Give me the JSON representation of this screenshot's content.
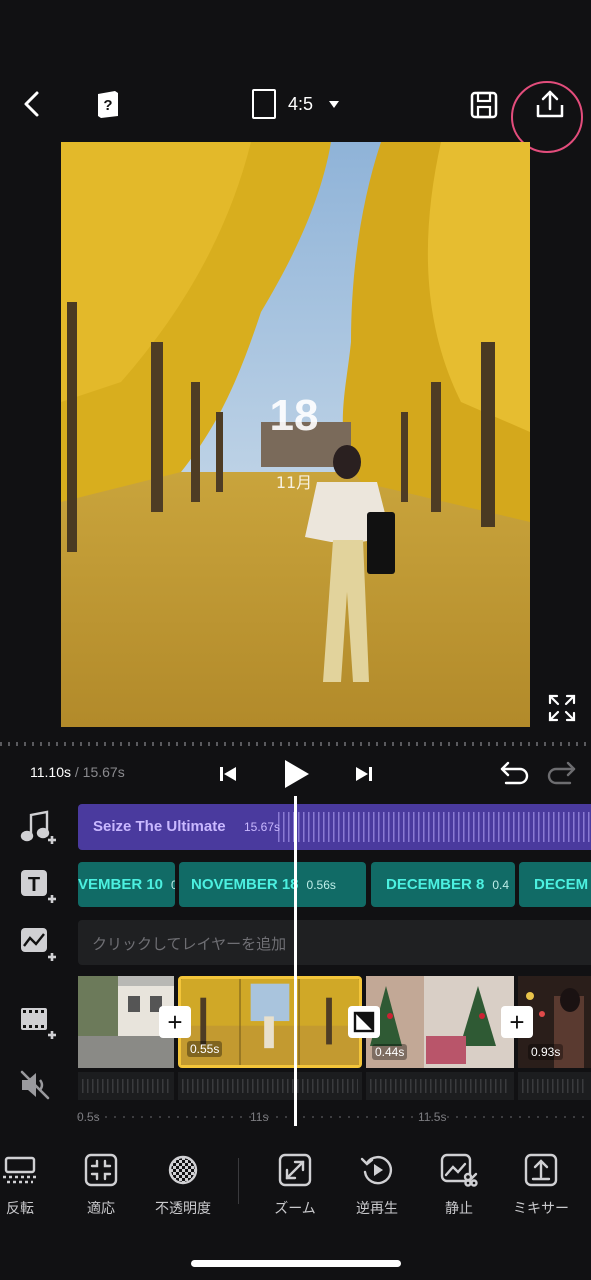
{
  "header": {
    "back_icon": "chevron-left-icon",
    "help_icon": "help-book-icon",
    "ratio_label": "4:5",
    "save_icon": "save-icon",
    "export_icon": "upload-icon",
    "highlight_color": "#e34d7c"
  },
  "preview": {
    "overlay_number": "18",
    "overlay_sub": "11月",
    "fullscreen_icon": "expand-icon"
  },
  "playback": {
    "current_time": "11.10s",
    "separator": " / ",
    "total_time": "15.67s",
    "undo_icon": "undo-icon",
    "redo_icon": "redo-icon"
  },
  "music": {
    "title": "Seize The Ultimate",
    "duration": "15.67s",
    "color": "#4a3a9e"
  },
  "text_clips": [
    {
      "label": "VEMBER 10",
      "dur": "0."
    },
    {
      "label": "NOVEMBER 18",
      "dur": "0.56s"
    },
    {
      "label": "DECEMBER 8",
      "dur": "0.4"
    },
    {
      "label": "DECEM",
      "dur": ""
    }
  ],
  "layer": {
    "placeholder": "クリックしてレイヤーを追加"
  },
  "video_clips": [
    {
      "dur": ""
    },
    {
      "dur": "0.55s"
    },
    {
      "dur": "0.44s"
    },
    {
      "dur": "0.93s"
    }
  ],
  "ruler": [
    "0.5s",
    "11s",
    "11.5s"
  ],
  "tools": [
    {
      "label": "反転",
      "icon": "flip-icon"
    },
    {
      "label": "適応",
      "icon": "fit-icon"
    },
    {
      "label": "不透明度",
      "icon": "opacity-icon"
    },
    {
      "label": "ズーム",
      "icon": "zoom-icon"
    },
    {
      "label": "逆再生",
      "icon": "reverse-icon"
    },
    {
      "label": "静止",
      "icon": "freeze-icon"
    },
    {
      "label": "ミキサー",
      "icon": "mixer-icon"
    }
  ]
}
